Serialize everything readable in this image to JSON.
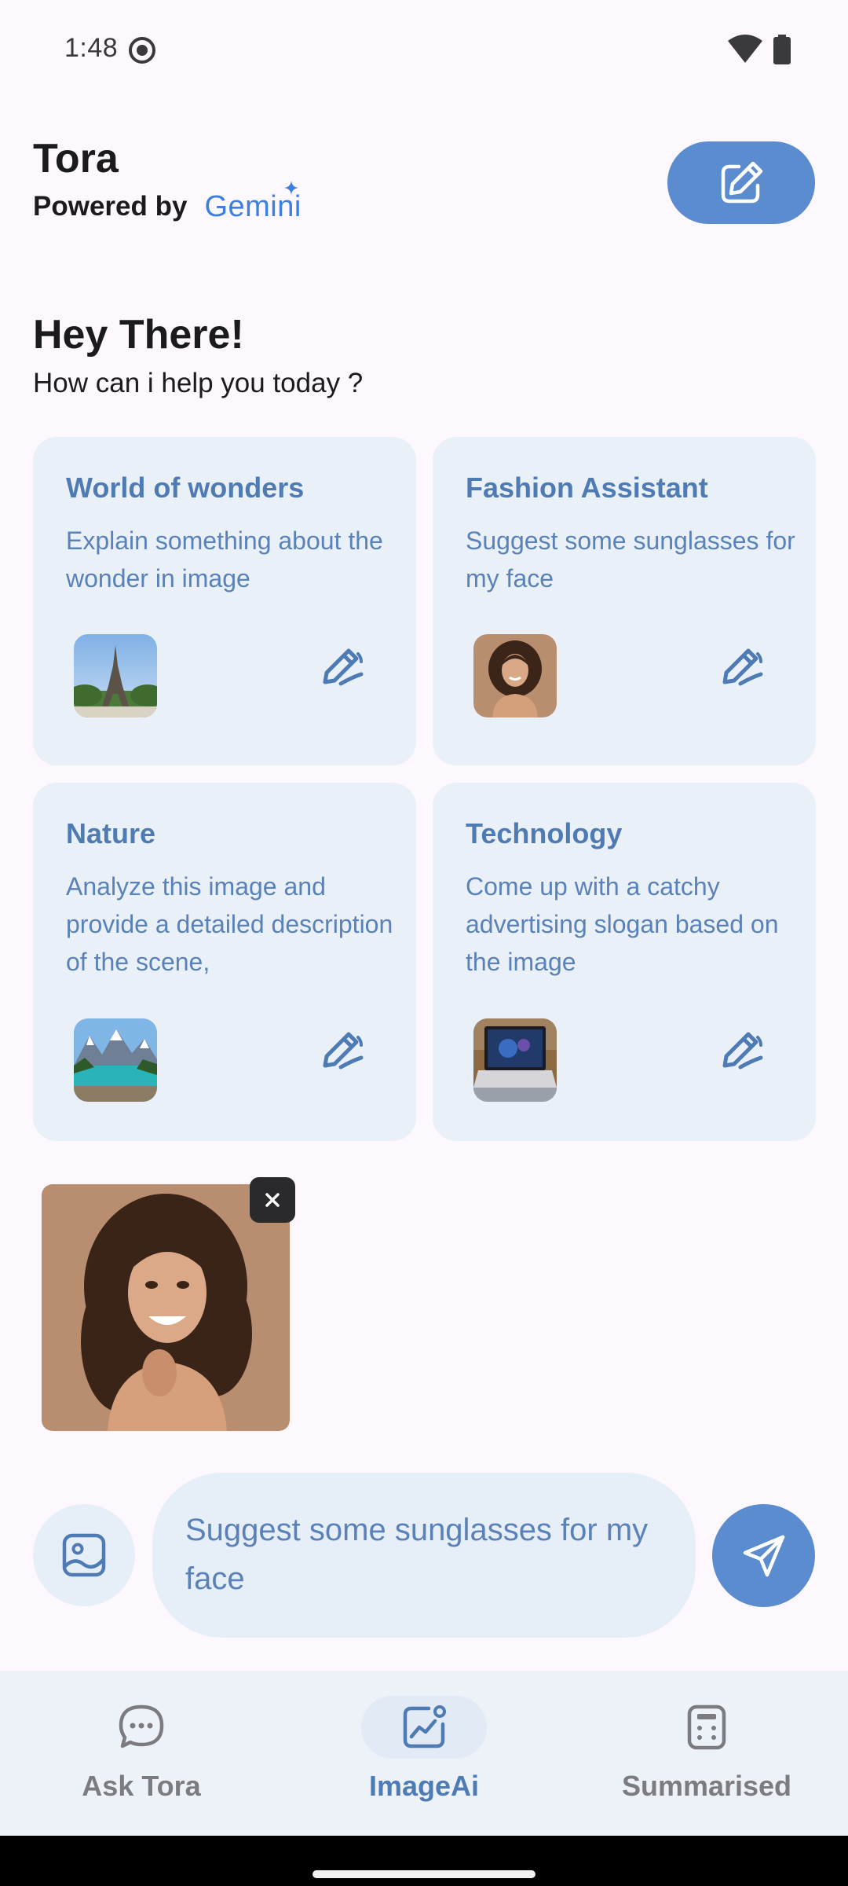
{
  "status_bar": {
    "time": "1:48"
  },
  "header": {
    "title": "Tora",
    "powered_by": "Powered by",
    "brand": "Gemini"
  },
  "greeting": {
    "title": "Hey There!",
    "subtitle": "How can i help you today ?"
  },
  "cards": [
    {
      "title": "World of wonders",
      "description": "Explain something about the wonder in image",
      "thumbnail": "eiffel-tower-image"
    },
    {
      "title": "Fashion Assistant",
      "description": "Suggest some sunglasses for my face",
      "thumbnail": "woman-portrait-image"
    },
    {
      "title": "Nature",
      "description": "Analyze this image and provide a detailed description of the scene,",
      "thumbnail": "mountain-lake-image"
    },
    {
      "title": "Technology",
      "description": "Come up with a catchy advertising slogan based on the image",
      "thumbnail": "laptop-image"
    }
  ],
  "attachment": {
    "image": "woman-portrait-image",
    "close_icon": "close-icon"
  },
  "input": {
    "value": "Suggest some sunglasses for my face"
  },
  "bottom_nav": {
    "items": [
      {
        "label": "Ask Tora",
        "icon": "chat-bubble-icon",
        "active": false
      },
      {
        "label": "ImageAi",
        "icon": "image-chart-icon",
        "active": true
      },
      {
        "label": "Summarised",
        "icon": "calculator-doc-icon",
        "active": false
      }
    ]
  },
  "colors": {
    "accent": "#5b8cd0",
    "card_bg": "#eaf0f8",
    "card_text": "#4f7bb4",
    "nav_active": "#4f7bb4",
    "nav_inactive": "#7b7b80",
    "background": "#fcf8fd"
  }
}
